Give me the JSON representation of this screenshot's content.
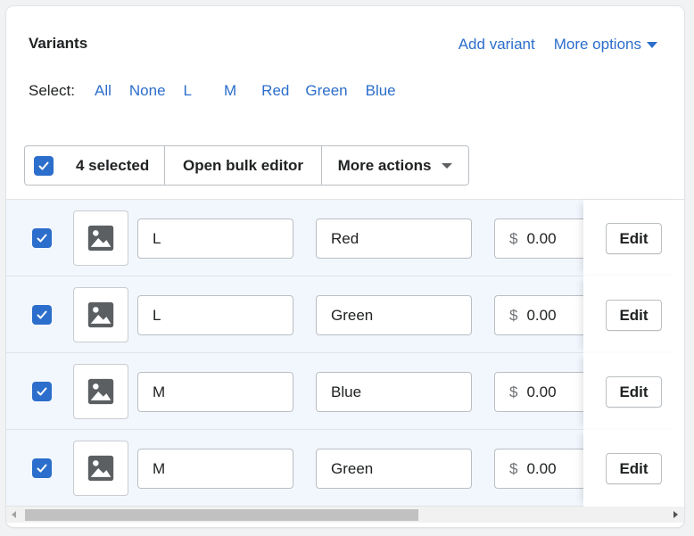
{
  "card": {
    "title": "Variants",
    "add_variant": "Add variant",
    "more_options": "More options"
  },
  "select": {
    "label": "Select:",
    "options": [
      "All",
      "None",
      "L",
      "M",
      "Red",
      "Green",
      "Blue"
    ]
  },
  "bulk": {
    "selected": "4 selected",
    "open_editor": "Open bulk editor",
    "more_actions": "More actions"
  },
  "rows": [
    {
      "size": "L",
      "color": "Red",
      "currency": "$",
      "price": "0.00",
      "edit": "Edit"
    },
    {
      "size": "L",
      "color": "Green",
      "currency": "$",
      "price": "0.00",
      "edit": "Edit"
    },
    {
      "size": "M",
      "color": "Blue",
      "currency": "$",
      "price": "0.00",
      "edit": "Edit"
    },
    {
      "size": "M",
      "color": "Green",
      "currency": "$",
      "price": "0.00",
      "edit": "Edit"
    }
  ],
  "colors": {
    "accent": "#2c6ecb",
    "row_selected_bg": "#f2f7fe"
  },
  "icons": {
    "checkbox": "checkmark-icon",
    "thumbnail": "image-icon",
    "caret": "caret-down-icon"
  }
}
